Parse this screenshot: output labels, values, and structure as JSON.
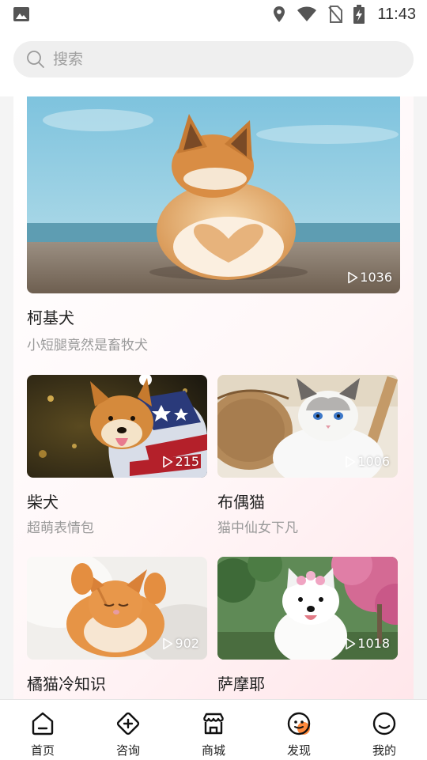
{
  "status_bar": {
    "time": "11:43",
    "icons": [
      "gallery-icon",
      "location-icon",
      "wifi-icon",
      "no-sim-icon",
      "battery-charging-icon"
    ]
  },
  "search": {
    "placeholder": "搜索",
    "icon": "search-icon"
  },
  "feed": {
    "featured": {
      "title": "柯基犬",
      "subtitle": "小短腿竟然是畜牧犬",
      "play_count": "1036"
    },
    "items": [
      {
        "title": "柴犬",
        "subtitle": "超萌表情包",
        "play_count": "215"
      },
      {
        "title": "布偶猫",
        "subtitle": "猫中仙女下凡",
        "play_count": "1006"
      },
      {
        "title": "橘猫冷知识",
        "subtitle": "",
        "play_count": "902"
      },
      {
        "title": "萨摩耶",
        "subtitle": "",
        "play_count": "1018"
      }
    ]
  },
  "bottom_nav": {
    "items": [
      {
        "label": "首页",
        "icon": "home-icon"
      },
      {
        "label": "咨询",
        "icon": "consult-icon"
      },
      {
        "label": "商城",
        "icon": "shop-icon"
      },
      {
        "label": "发现",
        "icon": "discover-icon"
      },
      {
        "label": "我的",
        "icon": "profile-icon"
      }
    ],
    "active_index": 3
  },
  "colors": {
    "accent": "#ff8a3d",
    "text_primary": "#222222",
    "text_secondary": "#999999",
    "search_bg": "#efefef"
  }
}
